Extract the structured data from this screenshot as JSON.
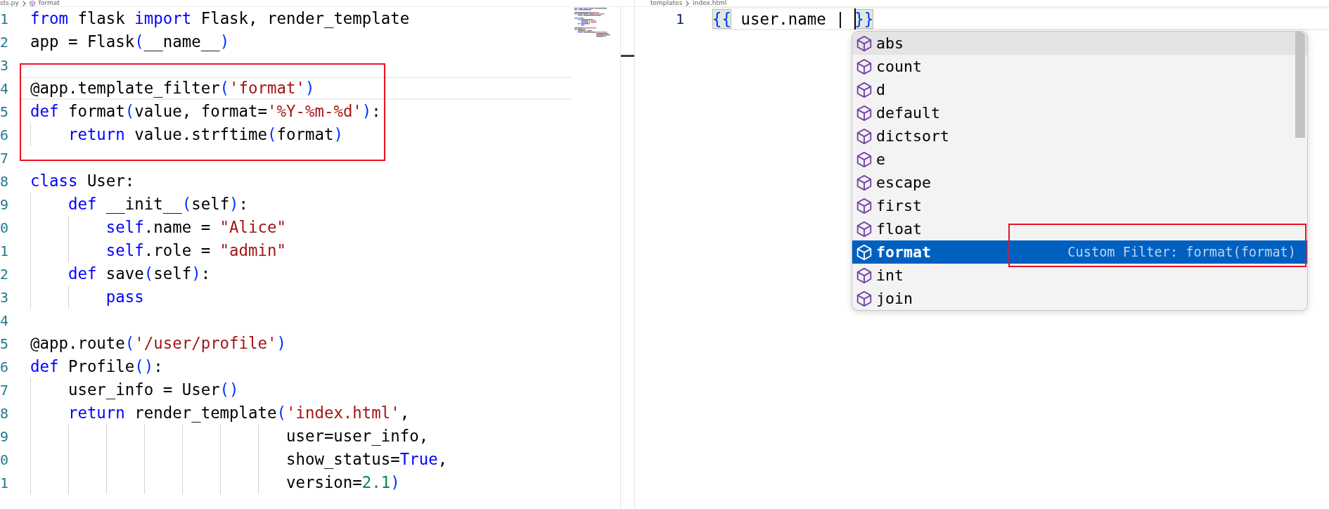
{
  "left_editor": {
    "breadcrumbs": [
      {
        "kind": "file",
        "label": "sts.py"
      },
      {
        "kind": "symbol",
        "label": "format"
      }
    ],
    "lines": [
      {
        "number": "1",
        "current": false,
        "boxed": false,
        "tokens": [
          {
            "kind": "keyword",
            "text": "from"
          },
          {
            "kind": "plain",
            "text": " flask "
          },
          {
            "kind": "keyword",
            "text": "import"
          },
          {
            "kind": "plain",
            "text": " Flask, render_template"
          }
        ]
      },
      {
        "number": "2",
        "current": false,
        "boxed": false,
        "tokens": [
          {
            "kind": "plain",
            "text": "app = Flask"
          },
          {
            "kind": "bracket",
            "text": "("
          },
          {
            "kind": "plain",
            "text": "__name__"
          },
          {
            "kind": "bracket",
            "text": ")"
          }
        ]
      },
      {
        "number": "3",
        "current": false,
        "boxed": false
      },
      {
        "number": "4",
        "current": true,
        "boxed": true,
        "tokens": [
          {
            "kind": "plain",
            "text": "@app.template_filter"
          },
          {
            "kind": "bracket",
            "text": "("
          },
          {
            "kind": "string",
            "text": "'format'"
          },
          {
            "kind": "bracket",
            "text": ")"
          }
        ]
      },
      {
        "number": "5",
        "current": false,
        "boxed": true,
        "tokens": [
          {
            "kind": "keyword",
            "text": "def"
          },
          {
            "kind": "plain",
            "text": " format"
          },
          {
            "kind": "bracket",
            "text": "("
          },
          {
            "kind": "plain",
            "text": "value, format="
          },
          {
            "kind": "string",
            "text": "'%Y-%m-%d'"
          },
          {
            "kind": "bracket",
            "text": ")"
          },
          {
            "kind": "plain",
            "text": ":"
          }
        ]
      },
      {
        "number": "6",
        "current": false,
        "boxed": true,
        "tokens": [
          {
            "kind": "keyword",
            "text": "    return"
          },
          {
            "kind": "plain",
            "text": " value.strftime"
          },
          {
            "kind": "bracket",
            "text": "("
          },
          {
            "kind": "plain",
            "text": "format"
          },
          {
            "kind": "bracket",
            "text": ")"
          }
        ]
      },
      {
        "number": "7",
        "current": false,
        "boxed": false
      },
      {
        "number": "8",
        "current": false,
        "boxed": false,
        "tokens": [
          {
            "kind": "keyword",
            "text": "class"
          },
          {
            "kind": "plain",
            "text": " User:"
          }
        ]
      },
      {
        "number": "9",
        "current": false,
        "boxed": false,
        "tokens": [
          {
            "kind": "keyword",
            "text": "    def"
          },
          {
            "kind": "plain",
            "text": " __init__"
          },
          {
            "kind": "bracket",
            "text": "("
          },
          {
            "kind": "plain",
            "text": "self"
          },
          {
            "kind": "bracket",
            "text": ")"
          },
          {
            "kind": "plain",
            "text": ":"
          }
        ]
      },
      {
        "number": "0",
        "current": false,
        "boxed": false,
        "tokens": [
          {
            "kind": "keyword",
            "text": "        self"
          },
          {
            "kind": "plain",
            "text": ".name = "
          },
          {
            "kind": "string",
            "text": "\"Alice\""
          }
        ]
      },
      {
        "number": "1",
        "current": false,
        "boxed": false,
        "tokens": [
          {
            "kind": "keyword",
            "text": "        self"
          },
          {
            "kind": "plain",
            "text": ".role = "
          },
          {
            "kind": "string",
            "text": "\"admin\""
          }
        ]
      },
      {
        "number": "2",
        "current": false,
        "boxed": false,
        "tokens": [
          {
            "kind": "keyword",
            "text": "    def"
          },
          {
            "kind": "plain",
            "text": " save"
          },
          {
            "kind": "bracket",
            "text": "("
          },
          {
            "kind": "plain",
            "text": "self"
          },
          {
            "kind": "bracket",
            "text": ")"
          },
          {
            "kind": "plain",
            "text": ":"
          }
        ]
      },
      {
        "number": "3",
        "current": false,
        "boxed": false,
        "tokens": [
          {
            "kind": "keyword",
            "text": "        pass"
          }
        ]
      },
      {
        "number": "4",
        "current": false,
        "boxed": false
      },
      {
        "number": "5",
        "current": false,
        "boxed": false,
        "tokens": [
          {
            "kind": "plain",
            "text": "@app.route"
          },
          {
            "kind": "bracket",
            "text": "("
          },
          {
            "kind": "string",
            "text": "'/user/profile'"
          },
          {
            "kind": "bracket",
            "text": ")"
          }
        ]
      },
      {
        "number": "6",
        "current": false,
        "boxed": false,
        "tokens": [
          {
            "kind": "keyword",
            "text": "def"
          },
          {
            "kind": "plain",
            "text": " Profile"
          },
          {
            "kind": "bracket",
            "text": "()"
          },
          {
            "kind": "plain",
            "text": ":"
          }
        ]
      },
      {
        "number": "7",
        "current": false,
        "boxed": false,
        "tokens": [
          {
            "kind": "plain",
            "text": "    user_info = User"
          },
          {
            "kind": "bracket",
            "text": "()"
          }
        ]
      },
      {
        "number": "8",
        "current": false,
        "boxed": false,
        "tokens": [
          {
            "kind": "keyword",
            "text": "    return"
          },
          {
            "kind": "plain",
            "text": " render_template"
          },
          {
            "kind": "bracket",
            "text": "("
          },
          {
            "kind": "string",
            "text": "'index.html'"
          },
          {
            "kind": "plain",
            "text": ","
          }
        ]
      },
      {
        "number": "9",
        "current": false,
        "boxed": false,
        "tokens": [
          {
            "kind": "plain",
            "text": "                           user=user_info,"
          }
        ]
      },
      {
        "number": "0",
        "current": false,
        "boxed": false,
        "tokens": [
          {
            "kind": "plain",
            "text": "                           show_status="
          },
          {
            "kind": "keyword",
            "text": "True"
          },
          {
            "kind": "plain",
            "text": ","
          }
        ]
      },
      {
        "number": "1",
        "current": false,
        "boxed": false,
        "tokens": [
          {
            "kind": "plain",
            "text": "                           version="
          },
          {
            "kind": "number",
            "text": "2.1"
          },
          {
            "kind": "bracket",
            "text": ")"
          }
        ]
      }
    ]
  },
  "right_editor": {
    "breadcrumbs": [
      {
        "label": "templates"
      },
      {
        "label": "index.html"
      }
    ],
    "lines": [
      {
        "number": "1",
        "current": true,
        "tokens": [
          {
            "kind": "bracket",
            "text": "{{",
            "matched": true,
            "cursor": false
          },
          {
            "kind": "plain",
            "text": " user.name | ",
            "matched": false,
            "cursor": false
          },
          {
            "kind": "bracket",
            "text": "}}",
            "matched": true,
            "cursor": true
          }
        ]
      }
    ]
  },
  "suggestions": {
    "items": [
      {
        "label": "abs",
        "selected": false,
        "hovered": true,
        "boxed": false
      },
      {
        "label": "count",
        "selected": false,
        "hovered": false,
        "boxed": false
      },
      {
        "label": "d",
        "selected": false,
        "hovered": false,
        "boxed": false
      },
      {
        "label": "default",
        "selected": false,
        "hovered": false,
        "boxed": false
      },
      {
        "label": "dictsort",
        "selected": false,
        "hovered": false,
        "boxed": false
      },
      {
        "label": "e",
        "selected": false,
        "hovered": false,
        "boxed": false
      },
      {
        "label": "escape",
        "selected": false,
        "hovered": false,
        "boxed": false
      },
      {
        "label": "first",
        "selected": false,
        "hovered": false,
        "boxed": false
      },
      {
        "label": "float",
        "selected": false,
        "hovered": false,
        "boxed": false
      },
      {
        "label": "format",
        "selected": true,
        "hovered": false,
        "boxed": true,
        "detail": "Custom Filter: format(format)"
      },
      {
        "label": "int",
        "selected": false,
        "hovered": false,
        "boxed": false
      },
      {
        "label": "join",
        "selected": false,
        "hovered": false,
        "boxed": false
      }
    ]
  }
}
